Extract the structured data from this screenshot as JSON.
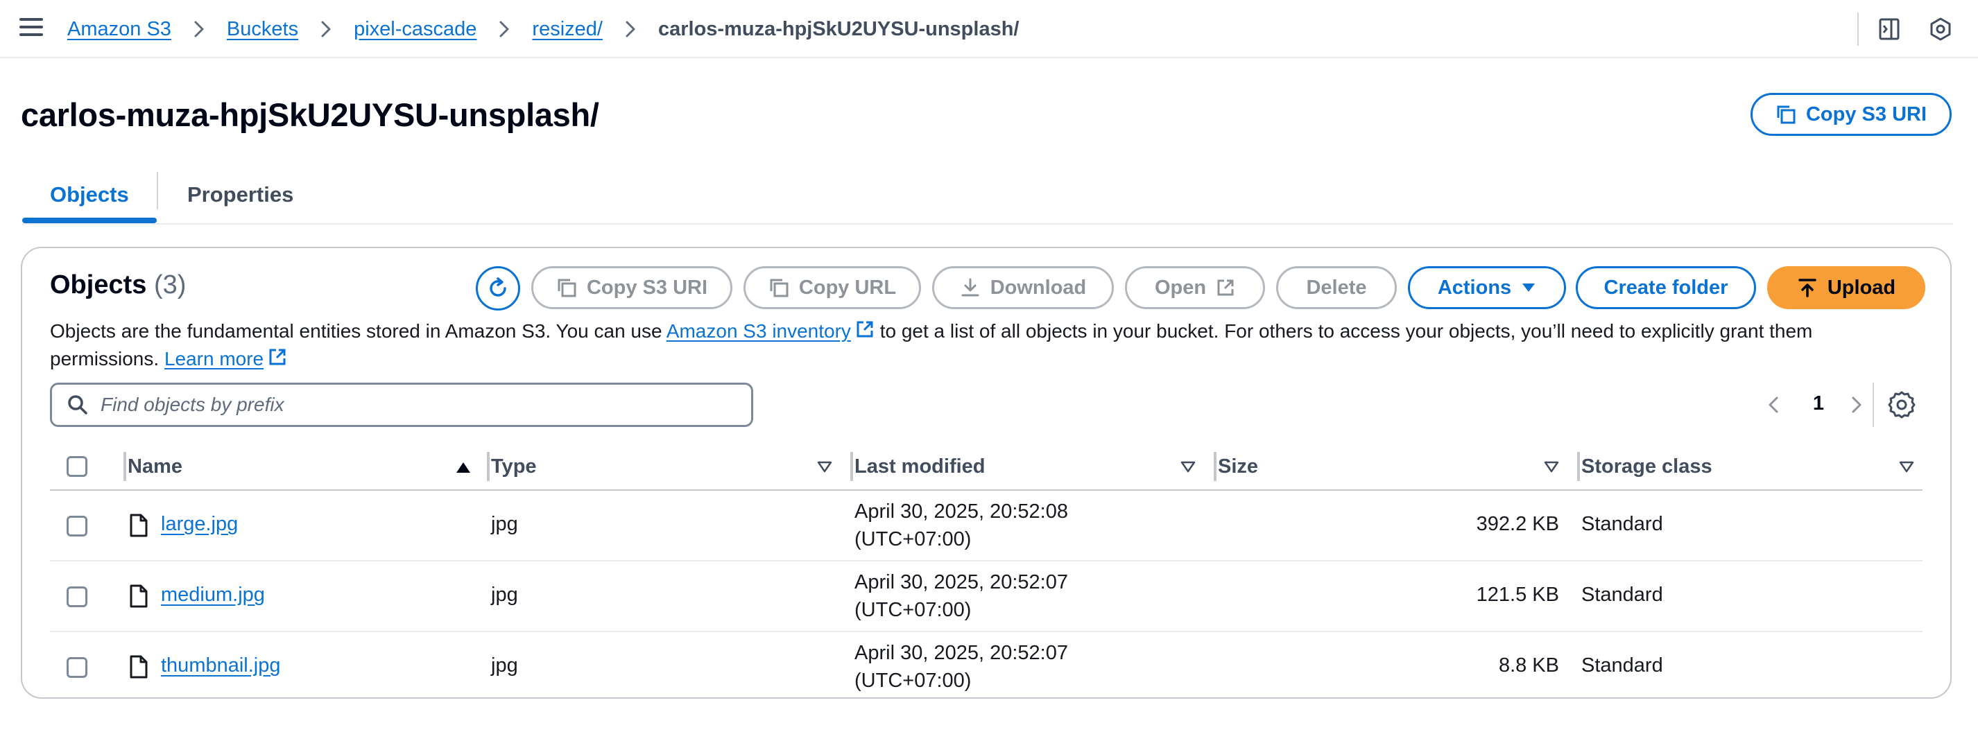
{
  "breadcrumb": {
    "items": [
      "Amazon S3",
      "Buckets",
      "pixel-cascade",
      "resized/"
    ],
    "current": "carlos-muza-hpjSkU2UYSU-unsplash/"
  },
  "header": {
    "title": "carlos-muza-hpjSkU2UYSU-unsplash/",
    "copy_uri_label": "Copy S3 URI"
  },
  "tabs": [
    {
      "label": "Objects",
      "active": true
    },
    {
      "label": "Properties",
      "active": false
    }
  ],
  "objects_panel": {
    "heading": "Objects",
    "count": "(3)",
    "buttons": {
      "copy_s3_uri": "Copy S3 URI",
      "copy_url": "Copy URL",
      "download": "Download",
      "open": "Open",
      "delete": "Delete",
      "actions": "Actions",
      "create_folder": "Create folder",
      "upload": "Upload"
    },
    "description": {
      "part1": "Objects are the fundamental entities stored in Amazon S3. You can use ",
      "inventory_link": "Amazon S3 inventory",
      "part2": " to get a list of all objects in your bucket. For others to access your objects, you’ll need to explicitly grant them permissions. ",
      "learn_more": "Learn more"
    },
    "search": {
      "placeholder": "Find objects by prefix",
      "value": ""
    },
    "pagination": {
      "current_page": "1"
    }
  },
  "table": {
    "columns": [
      "Name",
      "Type",
      "Last modified",
      "Size",
      "Storage class"
    ],
    "rows": [
      {
        "name": "large.jpg",
        "type": "jpg",
        "modified_line1": "April 30, 2025, 20:52:08",
        "modified_line2": "(UTC+07:00)",
        "size": "392.2 KB",
        "storage_class": "Standard"
      },
      {
        "name": "medium.jpg",
        "type": "jpg",
        "modified_line1": "April 30, 2025, 20:52:07",
        "modified_line2": "(UTC+07:00)",
        "size": "121.5 KB",
        "storage_class": "Standard"
      },
      {
        "name": "thumbnail.jpg",
        "type": "jpg",
        "modified_line1": "April 30, 2025, 20:52:07",
        "modified_line2": "(UTC+07:00)",
        "size": "8.8 KB",
        "storage_class": "Standard"
      }
    ]
  },
  "colors": {
    "link": "#0972d3",
    "primary_button": "#f89e36",
    "disabled": "#8d9399",
    "border": "#c6c6cd"
  },
  "icons": [
    "menu-icon",
    "chevron-right-icon",
    "panel-icon",
    "settings-hex-icon",
    "copy-icon",
    "download-icon",
    "external-link-icon",
    "caret-down-icon",
    "upload-icon",
    "refresh-icon",
    "search-icon",
    "chevron-left-icon",
    "gear-icon",
    "sort-ascending-icon",
    "sort-descending-icon",
    "file-icon"
  ]
}
